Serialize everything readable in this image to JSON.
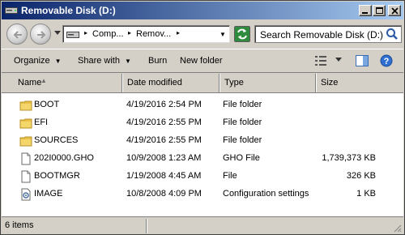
{
  "window": {
    "title": "Removable Disk (D:)",
    "icon": "drive-icon",
    "controls": [
      "minimize-icon",
      "maximize-icon",
      "close-icon"
    ]
  },
  "nav": {
    "back_icon": "back-arrow-icon",
    "forward_icon": "forward-arrow-icon",
    "breadcrumbs": [
      "Comp...",
      "Remov..."
    ],
    "refresh_icon": "refresh-icon",
    "search_placeholder": "Search Removable Disk (D:)"
  },
  "toolbar": {
    "organize": "Organize",
    "share_with": "Share with",
    "burn": "Burn",
    "new_folder": "New folder"
  },
  "columns": {
    "name": "Name",
    "date": "Date modified",
    "type": "Type",
    "size": "Size"
  },
  "files": [
    {
      "name": "BOOT",
      "date": "4/19/2016 2:54 PM",
      "type": "File folder",
      "size": "",
      "icon": "folder-icon"
    },
    {
      "name": "EFI",
      "date": "4/19/2016 2:55 PM",
      "type": "File folder",
      "size": "",
      "icon": "folder-icon"
    },
    {
      "name": "SOURCES",
      "date": "4/19/2016 2:55 PM",
      "type": "File folder",
      "size": "",
      "icon": "folder-icon"
    },
    {
      "name": "202I0000.GHO",
      "date": "10/9/2008 1:23 AM",
      "type": "GHO File",
      "size": "1,739,373 KB",
      "icon": "file-icon"
    },
    {
      "name": "BOOTMGR",
      "date": "1/19/2008 4:45 AM",
      "type": "File",
      "size": "326 KB",
      "icon": "file-icon"
    },
    {
      "name": "IMAGE",
      "date": "10/8/2008 4:09 PM",
      "type": "Configuration settings",
      "size": "1 KB",
      "icon": "config-file-icon"
    }
  ],
  "status": {
    "item_count": "6 items"
  },
  "colors": {
    "titlebar_start": "#0a246a",
    "titlebar_end": "#a6caf0",
    "folder": "#e8c14a",
    "chrome": "#d4d0c8"
  }
}
